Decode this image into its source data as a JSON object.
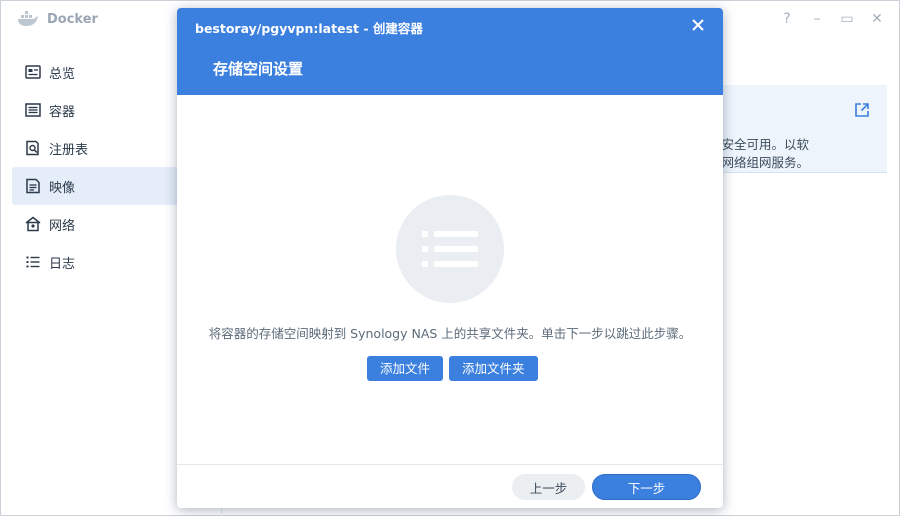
{
  "app": {
    "title": "Docker",
    "controls": [
      "?",
      "–",
      "▭",
      "✕"
    ]
  },
  "sidebar": {
    "items": [
      {
        "label": "总览",
        "icon": "overview-icon"
      },
      {
        "label": "容器",
        "icon": "container-icon"
      },
      {
        "label": "注册表",
        "icon": "registry-icon"
      },
      {
        "label": "映像",
        "icon": "image-icon",
        "active": true
      },
      {
        "label": "网络",
        "icon": "network-icon"
      },
      {
        "label": "日志",
        "icon": "log-icon"
      }
    ]
  },
  "banner": {
    "line1": "的安全可用。以软",
    "line2": "线网络组网服务。"
  },
  "modal": {
    "title": "bestoray/pgyvpn:latest - 创建容器",
    "step": "存储空间设置",
    "empty_text": "将容器的存储空间映射到 Synology NAS 上的共享文件夹。单击下一步以跳过此步骤。",
    "add_file": "添加文件",
    "add_folder": "添加文件夹",
    "prev": "上一步",
    "next": "下一步"
  },
  "colors": {
    "accent": "#3b7fdf",
    "active_bg": "#e4edf8"
  }
}
